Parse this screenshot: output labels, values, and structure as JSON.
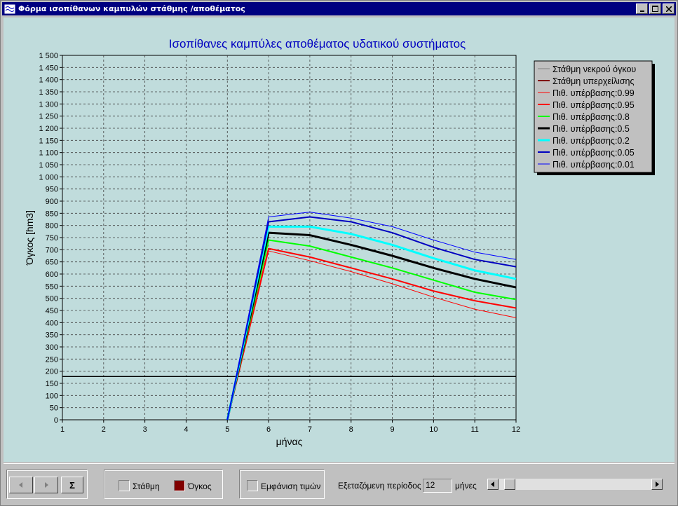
{
  "window": {
    "title": "Φόρμα ισοπίθανων καμπυλών στάθμης /αποθέματος",
    "icon": "wave-app-icon",
    "controls": [
      "minimize-icon",
      "maximize-icon",
      "close-icon"
    ]
  },
  "chart_data": {
    "type": "line",
    "title": "Ισοπίθανες καμπύλες αποθέματος υδατικού συστήματος",
    "xlabel": "μήνας",
    "ylabel": "Όγκος [hm3]",
    "xlim": [
      1,
      12
    ],
    "ylim": [
      0,
      1500
    ],
    "grid": true,
    "legend_position": "right",
    "x_ticks": [
      "1",
      "2",
      "3",
      "4",
      "5",
      "6",
      "7",
      "8",
      "9",
      "10",
      "11",
      "12"
    ],
    "y_ticks": [
      "0",
      "50",
      "100",
      "150",
      "200",
      "250",
      "300",
      "350",
      "400",
      "450",
      "500",
      "550",
      "600",
      "650",
      "700",
      "750",
      "800",
      "850",
      "900",
      "950",
      "1 000",
      "1 050",
      "1 100",
      "1 150",
      "1 200",
      "1 250",
      "1 300",
      "1 350",
      "1 400",
      "1 450",
      "1 500"
    ],
    "series": [
      {
        "name": "Στάθμη νεκρού όγκου",
        "color": "#808080",
        "width": 1,
        "x": [
          1,
          12
        ],
        "y": [
          178,
          178
        ]
      },
      {
        "name": "Στάθμη υπερχείλισης",
        "color": "#800000",
        "width": 2,
        "x": [],
        "y": []
      },
      {
        "name": "Πιθ. υπέρβασης:0.99",
        "color": "#ff0000",
        "width": 1,
        "x": [
          5,
          6,
          7,
          8,
          9,
          10,
          11,
          12
        ],
        "y": [
          0,
          695,
          655,
          610,
          560,
          505,
          455,
          420
        ]
      },
      {
        "name": "Πιθ. υπέρβασης:0.95",
        "color": "#ff0000",
        "width": 2,
        "x": [
          5,
          6,
          7,
          8,
          9,
          10,
          11,
          12
        ],
        "y": [
          0,
          705,
          670,
          625,
          580,
          530,
          490,
          460
        ]
      },
      {
        "name": "Πιθ. υπέρβασης:0.8",
        "color": "#00ff00",
        "width": 2,
        "x": [
          5,
          6,
          7,
          8,
          9,
          10,
          11,
          12
        ],
        "y": [
          0,
          740,
          715,
          670,
          625,
          575,
          525,
          495
        ]
      },
      {
        "name": "Πιθ. υπέρβασης:0.5",
        "color": "#000000",
        "width": 3,
        "x": [
          5,
          6,
          7,
          8,
          9,
          10,
          11,
          12
        ],
        "y": [
          0,
          770,
          760,
          720,
          675,
          625,
          580,
          545
        ]
      },
      {
        "name": "Πιθ. υπέρβασης:0.2",
        "color": "#00ffff",
        "width": 3,
        "x": [
          5,
          6,
          7,
          8,
          9,
          10,
          11,
          12
        ],
        "y": [
          0,
          795,
          795,
          765,
          720,
          665,
          615,
          580
        ]
      },
      {
        "name": "Πιθ. υπέρβασης:0.05",
        "color": "#0000c0",
        "width": 2,
        "x": [
          5,
          6,
          7,
          8,
          9,
          10,
          11,
          12
        ],
        "y": [
          0,
          815,
          835,
          815,
          770,
          710,
          660,
          630
        ]
      },
      {
        "name": "Πιθ. υπέρβασης:0.01",
        "color": "#0000ff",
        "width": 1,
        "x": [
          5,
          6,
          7,
          8,
          9,
          10,
          11,
          12
        ],
        "y": [
          0,
          835,
          855,
          830,
          795,
          740,
          690,
          660
        ]
      }
    ]
  },
  "bottom": {
    "prev_icon": "arrow-left-icon",
    "next_icon": "arrow-right-icon",
    "sum_label": "Σ",
    "stathmi_label": "Στάθμη",
    "ogkos_label": "Όγκος",
    "ogkos_color": "#800000",
    "show_values_label": "Εμφάνιση τιμών",
    "period_label": "Εξεταζόμενη περίοδος :",
    "period_value": "12",
    "period_unit": "μήνες",
    "slider_value": 12
  }
}
